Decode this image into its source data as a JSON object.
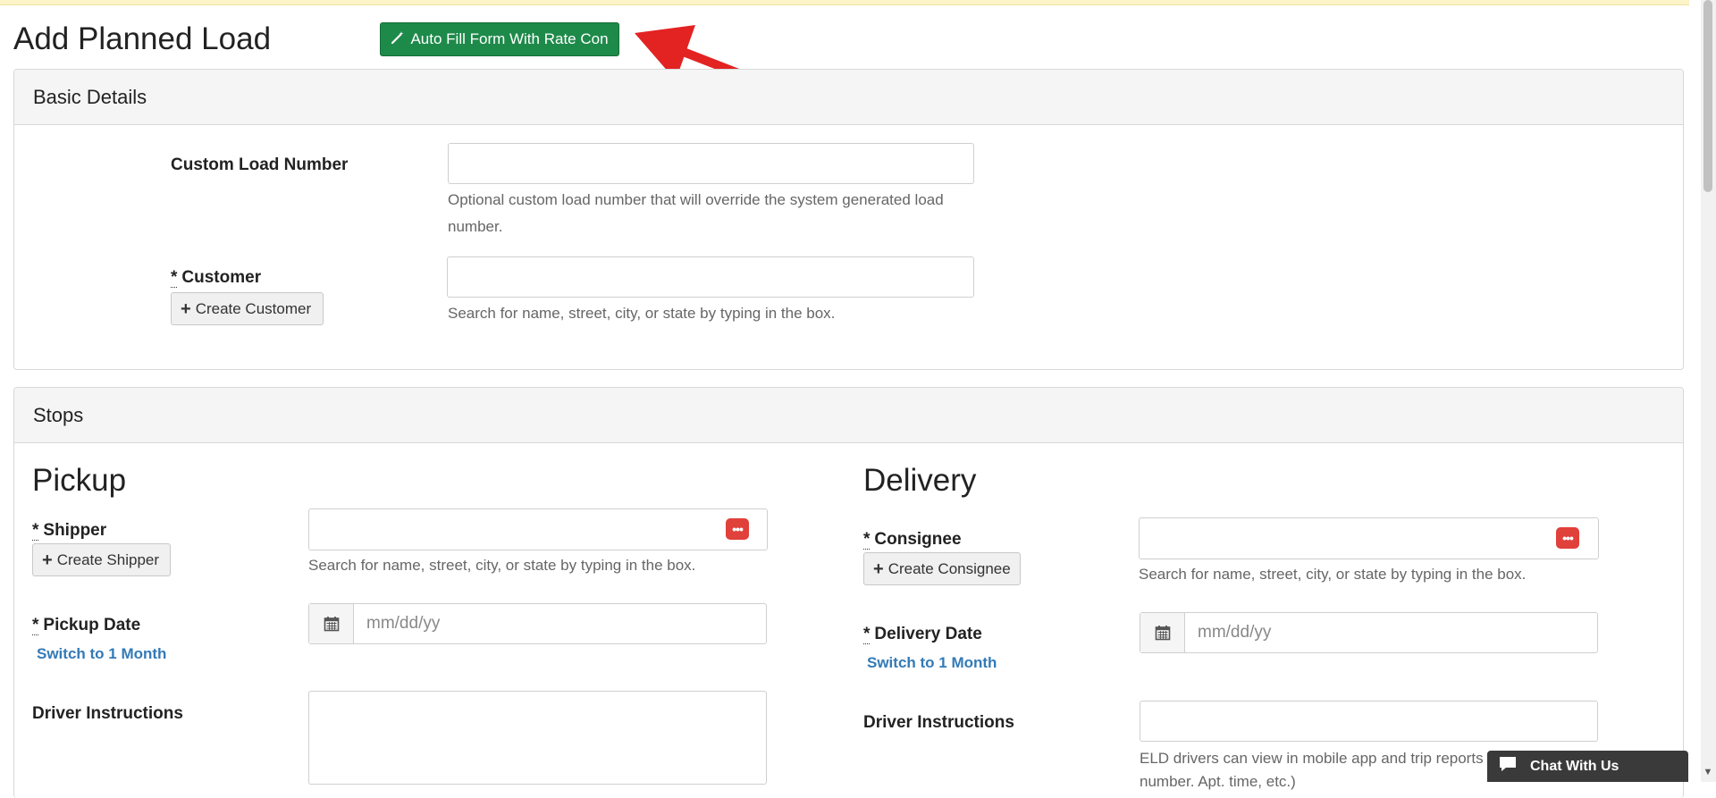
{
  "page": {
    "title": "Add Planned Load",
    "autofill_button": "Auto Fill Form With Rate Con"
  },
  "basic": {
    "heading": "Basic Details",
    "custom_load_number": {
      "label": "Custom Load Number",
      "value": "",
      "help_line1": "Optional custom load number that will override the system generated load",
      "help_line2": "number."
    },
    "customer": {
      "required_mark": "*",
      "label": "Customer",
      "value": "",
      "create_button": "Create Customer",
      "help": "Search for name, street, city, or state by typing in the box."
    }
  },
  "stops": {
    "heading": "Stops",
    "pickup": {
      "title": "Pickup",
      "shipper_required": "*",
      "shipper_label": "Shipper",
      "shipper_value": "",
      "create_shipper": "Create Shipper",
      "shipper_help": "Search for name, street, city, or state by typing in the box.",
      "date_required": "*",
      "date_label": "Pickup Date",
      "date_placeholder": "mm/dd/yy",
      "switch_link": "Switch to 1 Month",
      "driver_instructions_label": "Driver Instructions",
      "driver_instructions_value": ""
    },
    "delivery": {
      "title": "Delivery",
      "consignee_required": "*",
      "consignee_label": "Consignee",
      "consignee_value": "",
      "create_consignee": "Create Consignee",
      "consignee_help": "Search for name, street, city, or state by typing in the box.",
      "date_required": "*",
      "date_label": "Delivery Date",
      "date_placeholder": "mm/dd/yy",
      "switch_link": "Switch to 1 Month",
      "driver_instructions_label": "Driver Instructions",
      "driver_instructions_value": "",
      "driver_instructions_help_line1": "ELD drivers can view in mobile app and trip reports",
      "driver_instructions_help_line2": "number. Apt. time, etc.)"
    }
  },
  "chat": {
    "label": "Chat With Us"
  },
  "icons": {
    "autofill": "magic-wand-icon",
    "plus": "plus-icon",
    "calendar": "calendar-icon",
    "lookup": "more-dots-icon",
    "chat": "chat-bubble-icon",
    "annotation": "red-arrow-annotation"
  },
  "colors": {
    "autofill_button": "#1e8a4a",
    "link": "#337ab7",
    "annotation_arrow": "#e32222",
    "lookup_badge": "#e0413a",
    "chat_widget": "#3a3a3a",
    "top_band": "#fcf3c8"
  }
}
